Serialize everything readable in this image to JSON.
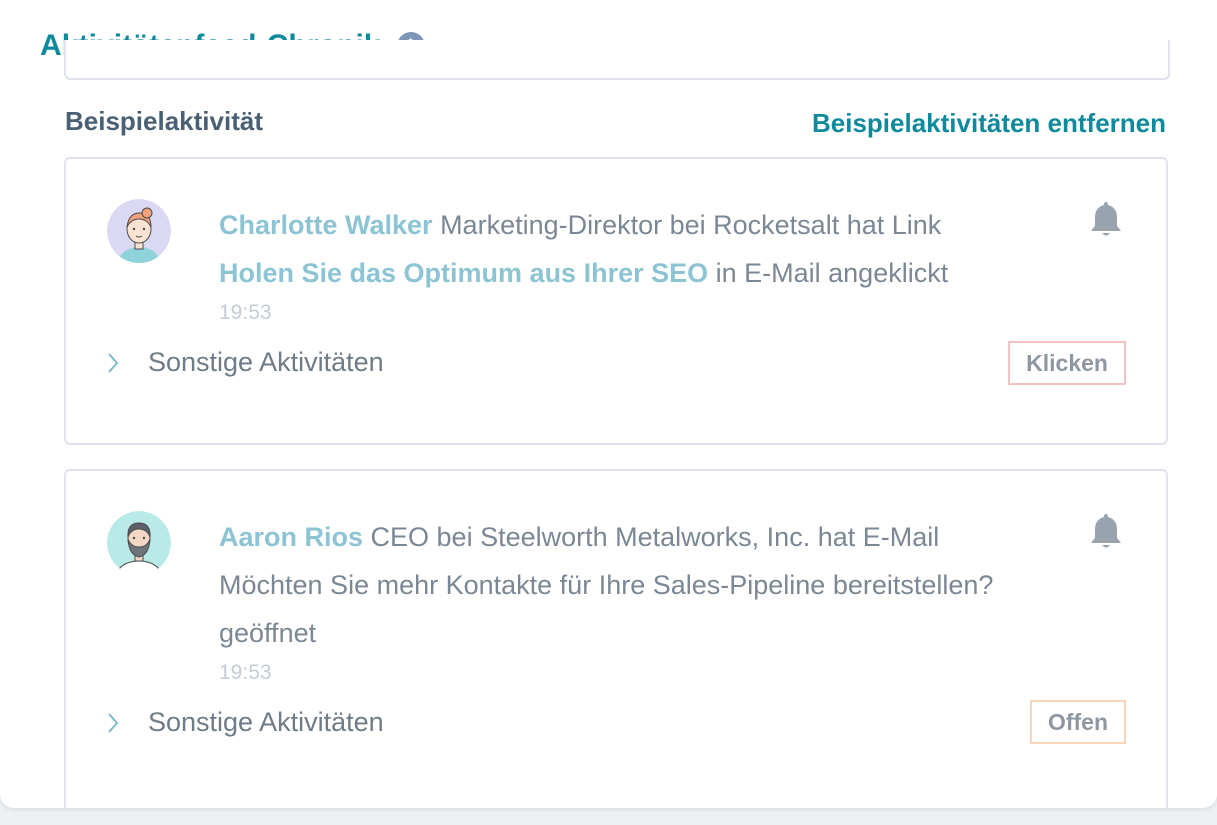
{
  "header": {
    "title": "Aktivitätenfeed-Chronik",
    "info_icon": "info-icon"
  },
  "section": {
    "label": "Beispielaktivität",
    "remove_link": "Beispielaktivitäten entfernen"
  },
  "activities": [
    {
      "avatar": "avatar-woman-icon",
      "name": "Charlotte Walker",
      "text_before_link": " Marketing-Direktor bei Rocketsalt hat Link ",
      "email_link": "Holen Sie das Optimum aus Ihrer SEO",
      "text_after_link": " in E-Mail angeklickt",
      "time": "19:53",
      "other_label": "Sonstige Aktivitäten",
      "tag": "Klicken",
      "tag_color": "#f2c3c3"
    },
    {
      "avatar": "avatar-bearded-man-icon",
      "name": "Aaron Rios",
      "text_before_link": " CEO bei Steelworth Metalworks, Inc. hat E-Mail ",
      "email_subject": "Möchten Sie mehr Kontakte für Ihre Sales-Pipeline bereitstellen?",
      "text_after_link": " geöffnet",
      "time": "19:53",
      "other_label": "Sonstige Aktivitäten",
      "tag": "Offen",
      "tag_color": "#f8d4ba"
    }
  ],
  "colors": {
    "accent": "#0f8a9d",
    "link_light": "#8cc4d3",
    "text_gray": "#7b8794",
    "border": "#dfe3eb"
  }
}
